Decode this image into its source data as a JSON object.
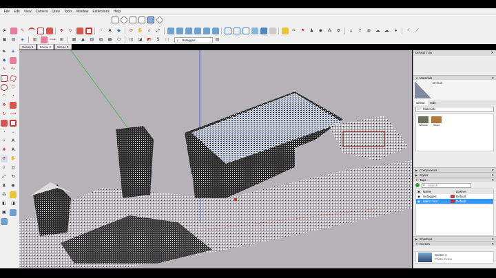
{
  "menubar": {
    "items": [
      "File",
      "Edit",
      "View",
      "Camera",
      "Draw",
      "Tools",
      "Window",
      "Extensions",
      "Help"
    ]
  },
  "layer_dropdown": {
    "value": "Untagged"
  },
  "scenes": {
    "tabs": [
      "Scene 1",
      "Scene 2",
      "Scene 3"
    ],
    "active": "Scene 2"
  },
  "tray": {
    "title": "Default Tray",
    "materials": {
      "title": "Materials",
      "swatch_name": "Default",
      "tabs": [
        "Select",
        "Edit"
      ],
      "library": "Materials",
      "items": [
        {
          "label": "Window",
          "color": "#6b6f5e"
        },
        {
          "label": "Wood",
          "color": "#b07a3c"
        }
      ]
    },
    "components": {
      "title": "Components"
    },
    "styles": {
      "title": "Styles"
    },
    "tags": {
      "title": "Tags",
      "search_placeholder": "Search",
      "headers": {
        "name": "Name",
        "dashes": "Dashes"
      },
      "rows": [
        {
          "name": "Untagged",
          "dashes": "Default",
          "color": "#c0404a"
        },
        {
          "name": "Main Floor",
          "dashes": "Default",
          "color": "#c03030"
        }
      ]
    },
    "shadows": {
      "title": "Shadows"
    },
    "scenes_panel": {
      "title": "Scenes",
      "entry_name": "Scene: 1",
      "entry_photo": "Photo: None"
    }
  },
  "colors": {
    "toolbar_bg": "#f0f0f0",
    "viewport_bg": "#b5b2b8",
    "selection": "#3399ff",
    "axis_blue": "#3b3bff",
    "axis_green": "#3db83d",
    "axis_red": "#ff4040"
  }
}
